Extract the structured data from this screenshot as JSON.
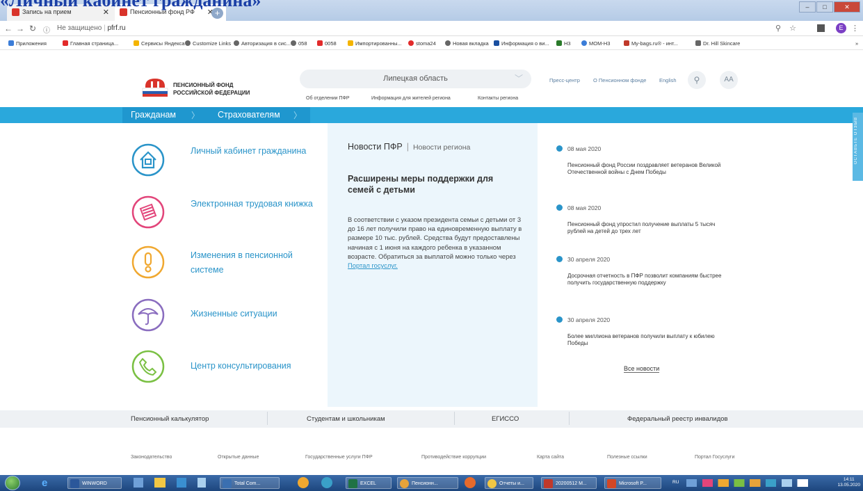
{
  "overlay_title": "«Личный кабинет гражданина»",
  "browser": {
    "tabs": [
      {
        "label": "Запись на прием"
      },
      {
        "label": "Пенсионный фонд РФ"
      }
    ],
    "new_tab": "+",
    "address": {
      "not_secure": "Не защищено",
      "url": "pfrf.ru"
    },
    "profile_initial": "E",
    "bookmarks": [
      {
        "label": "Приложения",
        "color": "#3b7dd8"
      },
      {
        "label": "Главная страница...",
        "color": "#e22b2b"
      },
      {
        "label": "Сервисы Яндекса",
        "color": "#f4b400"
      },
      {
        "label": "Customize Links",
        "color": "#666666"
      },
      {
        "label": "Авторизация в сис...",
        "color": "#666666"
      },
      {
        "label": "058",
        "color": "#666666"
      },
      {
        "label": "0058",
        "color": "#e22b2b"
      },
      {
        "label": "Импортированны...",
        "color": "#f4b400"
      },
      {
        "label": "stoma24",
        "color": "#e22b2b"
      },
      {
        "label": "Новая вкладка",
        "color": "#666666"
      },
      {
        "label": "Информация о ви...",
        "color": "#1a4fa0"
      },
      {
        "label": "Н3",
        "color": "#2a7a2a"
      },
      {
        "label": "МОМ-Н3",
        "color": "#3b7dd8"
      },
      {
        "label": "My-bags.ru® - инт...",
        "color": "#c0392b"
      },
      {
        "label": "Dr. Hill Skincare",
        "color": "#666666"
      }
    ],
    "bookmarks_more": "»"
  },
  "site": {
    "logo_line1": "ПЕНСИОННЫЙ ФОНД",
    "logo_line2": "РОССИЙСКОЙ ФЕДЕРАЦИИ",
    "region": "Липецкая область",
    "subnav": [
      "Об отделении ПФР",
      "Информация для жителей региона",
      "Контакты региона"
    ],
    "topnav": [
      "Пресс-центр",
      "О Пенсионном фонде",
      "English"
    ],
    "font_size_btn": "AA",
    "main_nav": [
      "Гражданам",
      "Страхователям"
    ],
    "feedback": "ОСТАВЬТЕ ОТЗЫВ",
    "menu": [
      {
        "label": "Личный кабинет гражданина",
        "color": "#2a94c9"
      },
      {
        "label": "Электронная трудовая книжка",
        "color": "#e2457a"
      },
      {
        "label": "Изменения в пенсионной системе",
        "color": "#f0a830"
      },
      {
        "label": "Жизненные ситуации",
        "color": "#8a6dbf"
      },
      {
        "label": "Центр консультирования",
        "color": "#7ac043"
      }
    ],
    "news_panel": {
      "tab_active": "Новости ПФР",
      "tab_sep": "|",
      "tab_other": "Новости региона",
      "title": "Расширены меры поддержки для семей с детьми",
      "body": "В соответствии с указом президента семьи с детьми от 3 до 16 лет получили право на единовременную выплату в размере 10 тыс. рублей. Средства будут предоставлены начиная с 1 июня на каждого ребенка в указанном возрасте. Обратиться за выплатой можно только через",
      "link": "Портал госуслуг."
    },
    "news": [
      {
        "date": "08 мая 2020",
        "text": "Пенсионный фонд России поздравляет ветеранов Великой Отечественной войны с Днем Победы"
      },
      {
        "date": "08 мая 2020",
        "text": "Пенсионный фонд упростил получение выплаты 5 тысяч рублей на детей до трех лет"
      },
      {
        "date": "30 апреля 2020",
        "text": "Досрочная отчетность в ПФР позволит компаниям быстрее получить государственную поддержку"
      },
      {
        "date": "30 апреля 2020",
        "text": "Более миллиона ветеранов получили выплату к юбилею Победы"
      }
    ],
    "all_news": "Все новости",
    "footer_main": [
      "Пенсионный калькулятор",
      "Студентам и школьникам",
      "ЕГИССО",
      "Федеральный реестр инвалидов"
    ],
    "footer_links": [
      "Законодательство",
      "Открытые данные",
      "Государственные услуги ПФР",
      "Противодействие коррупции",
      "Карта сайта",
      "Полезные ссылки",
      "Портал Госуслуги"
    ]
  },
  "taskbar": {
    "items": [
      {
        "label": "WINWORD",
        "color": "#2b579a"
      },
      {
        "label": "Total Com...",
        "color": "#3b6fb0"
      },
      {
        "label": "EXCEL",
        "color": "#1f7244"
      },
      {
        "label": "Пенсионн...",
        "color": "#e8a33a"
      },
      {
        "label": "Отчеты и...",
        "color": "#f2c744"
      },
      {
        "label": "20200512 M...",
        "color": "#c0392b"
      },
      {
        "label": "Microsoft P...",
        "color": "#d24726"
      }
    ],
    "lang": "RU",
    "time": "14:11",
    "date": "13.05.2020"
  }
}
